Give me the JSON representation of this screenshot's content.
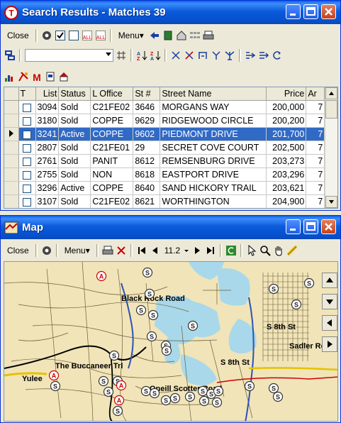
{
  "search": {
    "title": "Search Results - Matches 39",
    "close_label": "Close",
    "menu_label": "Menu",
    "filter_value": "",
    "columns": [
      "T",
      "List",
      "Status",
      "L Office",
      "St #",
      "Street Name",
      "Price",
      "Ar"
    ],
    "rows": [
      {
        "list": "3094",
        "status": "Sold",
        "office": "C21FE02",
        "stnum": "3646",
        "street": "MORGANS WAY",
        "price": "200,000",
        "ar": "7"
      },
      {
        "list": "3180",
        "status": "Sold",
        "office": "COPPE",
        "stnum": "9629",
        "street": "RIDGEWOOD CIRCLE",
        "price": "200,200",
        "ar": "7"
      },
      {
        "list": "3241",
        "status": "Active",
        "office": "COPPE",
        "stnum": "9602",
        "street": "PIEDMONT DRIVE",
        "price": "201,700",
        "ar": "7"
      },
      {
        "list": "2807",
        "status": "Sold",
        "office": "C21FE01",
        "stnum": "29",
        "street": "SECRET COVE COURT",
        "price": "202,500",
        "ar": "7"
      },
      {
        "list": "2761",
        "status": "Sold",
        "office": "PANIT",
        "stnum": "8612",
        "street": "REMSENBURG DRIVE",
        "price": "203,273",
        "ar": "7"
      },
      {
        "list": "2755",
        "status": "Sold",
        "office": "NON",
        "stnum": "8618",
        "street": "EASTPORT DRIVE",
        "price": "203,296",
        "ar": "7"
      },
      {
        "list": "3296",
        "status": "Active",
        "office": "COPPE",
        "stnum": "8640",
        "street": "SAND HICKORY TRAIL",
        "price": "203,621",
        "ar": "7"
      },
      {
        "list": "3107",
        "status": "Sold",
        "office": "C21FE02",
        "stnum": "8621",
        "street": "WORTHINGTON",
        "price": "204,900",
        "ar": "7"
      }
    ]
  },
  "map": {
    "title": "Map",
    "close_label": "Close",
    "menu_label": "Menu",
    "zoom": "11.2",
    "labels": {
      "blackrock": "Black Rock Road",
      "yulee": "Yulee",
      "buccaneer": "The Buccaneer Trl",
      "oneill": "Oneill Scotter Road",
      "st8a": "S 8th St",
      "st8b": "S 8th St",
      "sadler": "Sadler Road"
    }
  },
  "colors": {
    "titlebar": "#0a5fe6",
    "selection": "#316ac5",
    "map_land": "#f1e4b8",
    "map_water": "#a8d8ea"
  }
}
